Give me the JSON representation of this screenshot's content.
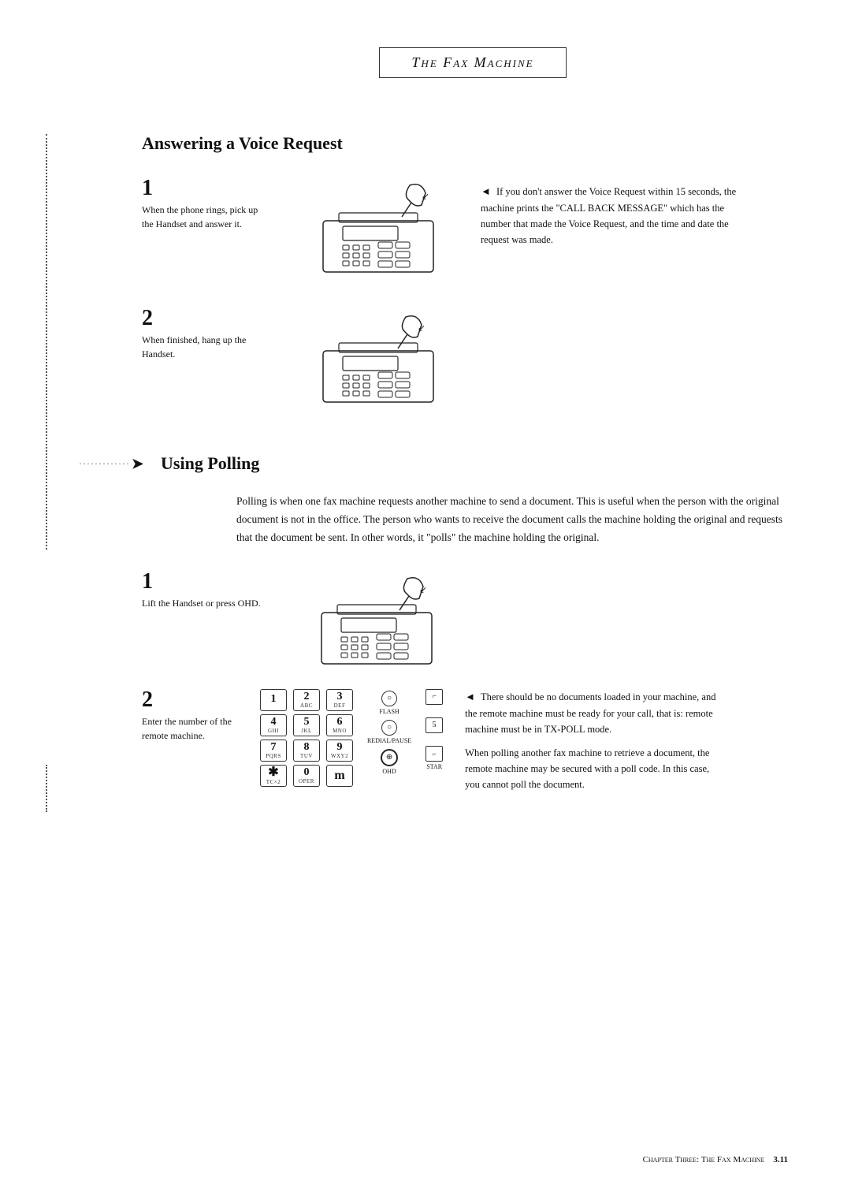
{
  "header": {
    "title": "The Fax Machine"
  },
  "answering_section": {
    "title": "Answering a Voice Request",
    "step1": {
      "number": "1",
      "text": "When the phone rings, pick up the Handset and answer it."
    },
    "step2": {
      "number": "2",
      "text": "When finished, hang up the Handset."
    },
    "side_note": "If you don't answer the Voice Request within 15 seconds, the machine prints the \"CALL BACK MESSAGE\" which has the number that made the Voice Request, and the time and date the request was made."
  },
  "polling_section": {
    "title": "Using  Polling",
    "intro": "Polling is when one fax machine requests another machine to send a document. This is useful when the person with the original document is not in the office. The person who wants to receive the document calls the machine holding the original and requests that the document be sent. In other words, it \"polls\" the machine holding the original.",
    "step1": {
      "number": "1",
      "text": "Lift the Handset or press OHD."
    },
    "step2": {
      "number": "2",
      "text": "Enter the number of the remote  machine."
    },
    "keypad": {
      "keys": [
        {
          "label": "1",
          "sub": ""
        },
        {
          "label": "2",
          "sub": "ABC"
        },
        {
          "label": "3",
          "sub": "DEF"
        },
        {
          "label": "4",
          "sub": "GHI"
        },
        {
          "label": "5",
          "sub": "JKL"
        },
        {
          "label": "6",
          "sub": "MNO"
        },
        {
          "label": "7",
          "sub": "PQRS"
        },
        {
          "label": "8",
          "sub": "TUV"
        },
        {
          "label": "9",
          "sub": "WXY2"
        },
        {
          "label": "✱",
          "sub": "TC×2"
        },
        {
          "label": "0",
          "sub": "OPER"
        },
        {
          "label": "m",
          "sub": ""
        }
      ],
      "right_buttons": [
        {
          "label": "FLASH",
          "type": "circle"
        },
        {
          "label": "REDIAL/PAUSE",
          "type": "circle"
        },
        {
          "label": "OHD",
          "type": "circle"
        }
      ],
      "side_buttons": [
        {
          "label": ""
        },
        {
          "label": "5"
        },
        {
          "label": "STAR"
        }
      ]
    },
    "notes": [
      "There should be no documents loaded in your machine, and the remote machine must be ready for your call, that is: remote machine must be in TX-POLL mode.",
      "When polling another fax machine to retrieve a document, the remote machine may be secured with a poll code. In this case, you cannot poll the document."
    ]
  },
  "footer": {
    "text": "Chapter Three: The Fax Machine",
    "page": "3.11"
  }
}
